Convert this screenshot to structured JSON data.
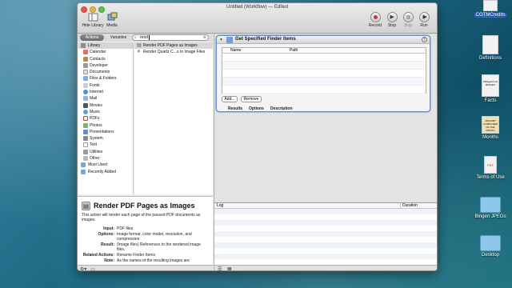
{
  "window": {
    "title": "Untitled (Workflow) — Edited",
    "toolbar": {
      "hide_library": "Hide Library",
      "media": "Media",
      "record": "Record",
      "step": "Step",
      "stop": "Stop",
      "run": "Run"
    }
  },
  "library": {
    "tabs": {
      "actions": "Actions",
      "variables": "Variables"
    },
    "search": {
      "value": "rend",
      "placeholder": ""
    },
    "root": "Library",
    "categories": [
      "Calendar",
      "Contacts",
      "Developer",
      "Documents",
      "Files & Folders",
      "Fonts",
      "Internet",
      "Mail",
      "Movies",
      "Music",
      "PDFs",
      "Photos",
      "Presentations",
      "System",
      "Text",
      "Utilities",
      "Other"
    ],
    "groups": [
      "Most Used",
      "Recently Added"
    ],
    "results": [
      "Render PDF Pages as Images",
      "Render Quartz C...s to Image Files"
    ]
  },
  "description": {
    "title": "Render PDF Pages as Images",
    "text": "This action will render each page of the passed PDF documents as images.",
    "input_label": "Input:",
    "input": "PDF files",
    "options_label": "Options:",
    "options": "Image format, color model, resolution, and compression",
    "result_label": "Result:",
    "result": "(Image files) References to the rendered image files.",
    "related_label": "Related Actions:",
    "related": "Rename Finder Items",
    "note_label": "Note:",
    "note": "As the names of the resulting images are"
  },
  "action": {
    "title": "Get Specified Finder Items",
    "columns": [
      "Name",
      "Path"
    ],
    "add_label": "Add...",
    "remove_label": "Remove",
    "tabs": [
      "Results",
      "Options",
      "Description"
    ]
  },
  "log": {
    "columns": [
      "Log",
      "Duration"
    ]
  },
  "desktop": {
    "icons": [
      "COTMCredits",
      "Definitions",
      "Facts",
      "Months",
      "Terms of Use",
      "Bingen JPEGs",
      "Desktop"
    ],
    "thumb_texts": {
      "antiphon": "ANTIPHON",
      "composer": "JANUARY COMPOSER OF THE MONTH",
      "bingen": "Hildegard von BINGEN"
    }
  },
  "colors": {
    "accent": "#3b6fd1",
    "record": "#d9302b",
    "selection": "#6a8fc6"
  }
}
